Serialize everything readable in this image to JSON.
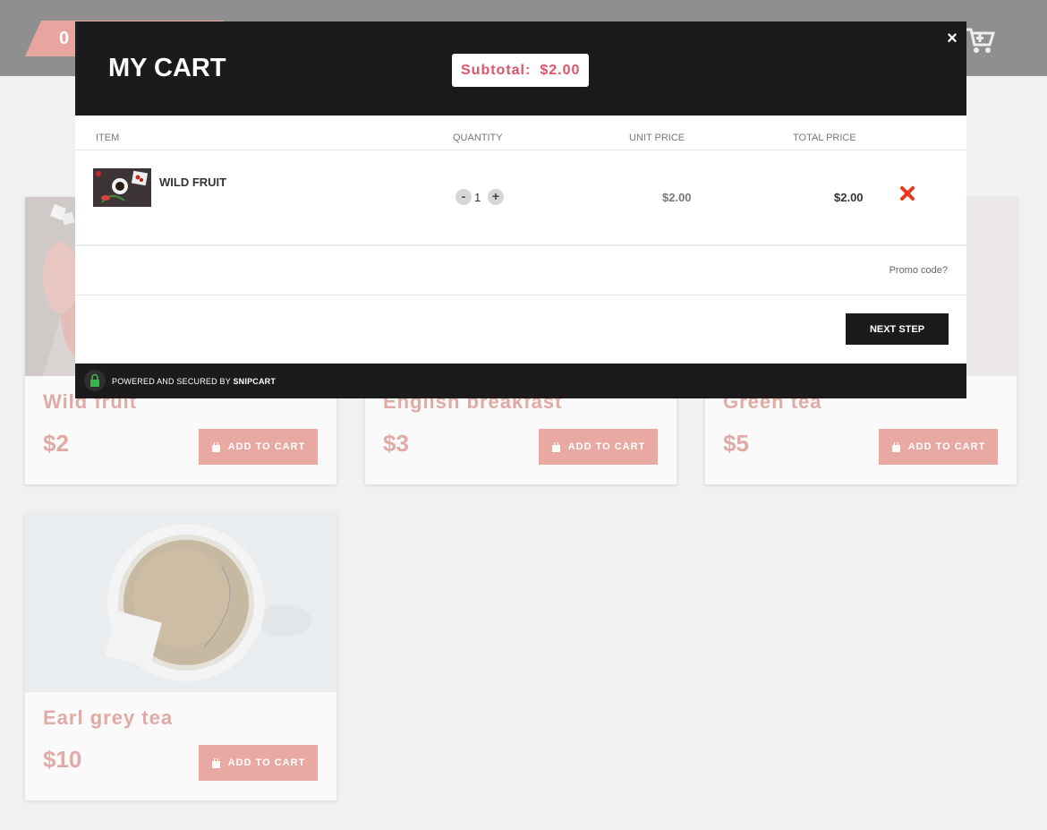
{
  "page": {
    "cart_count": "0",
    "products": [
      {
        "name": "Wild fruit",
        "price": "$2",
        "button": "ADD TO CART"
      },
      {
        "name": "English breakfast",
        "price": "$3",
        "button": "ADD TO CART"
      },
      {
        "name": "Green tea",
        "price": "$5",
        "button": "ADD TO CART"
      },
      {
        "name": "Earl grey tea",
        "price": "$10",
        "button": "ADD TO CART"
      }
    ]
  },
  "cart": {
    "title": "MY CART",
    "subtotal_label": "Subtotal:",
    "subtotal_value": "$2.00",
    "close": "×",
    "columns": {
      "item": "ITEM",
      "quantity": "QUANTITY",
      "unit_price": "UNIT PRICE",
      "total_price": "TOTAL PRICE"
    },
    "items": [
      {
        "name": "WILD FRUIT",
        "quantity": "1",
        "minus": "-",
        "plus": "+",
        "unit_price": "$2.00",
        "total_price": "$2.00"
      }
    ],
    "promo": "Promo code?",
    "next": "NEXT STEP",
    "powered_prefix": "POWERED AND SECURED BY",
    "powered_brand": "SNIPCART"
  },
  "colors": {
    "accent": "#e0536b",
    "dark": "#1b1b1b",
    "product_pink": "#e0aaa5",
    "remove_red": "#e8381e",
    "lock_green": "#3bb54a"
  }
}
